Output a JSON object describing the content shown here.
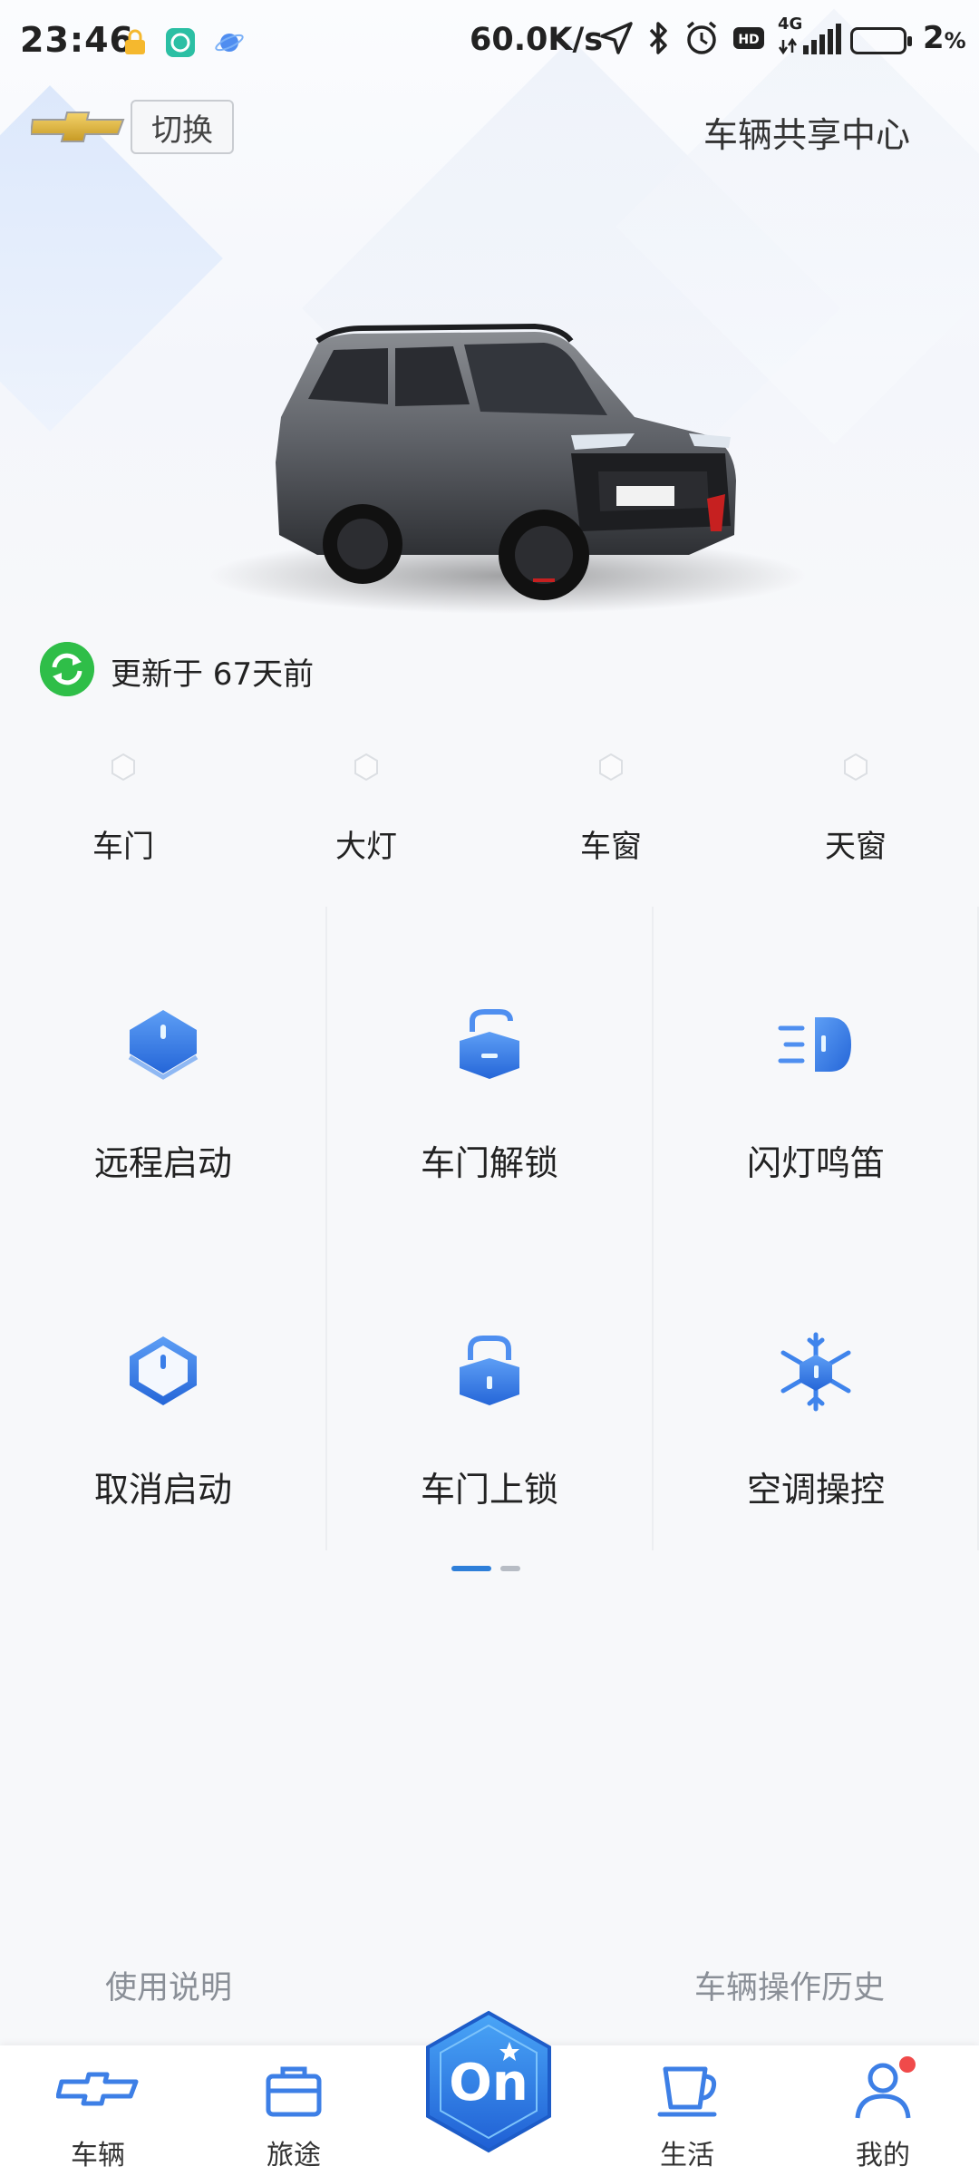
{
  "status_bar": {
    "time": "23:46",
    "net_speed": "60.0K/s",
    "battery_pct": "2",
    "battery_unit": "%",
    "network": "4G"
  },
  "header": {
    "switch_label": "切换",
    "share_center": "车辆共享中心"
  },
  "update": {
    "text": "更新于 67天前"
  },
  "vehicle_status": [
    {
      "label": "车门"
    },
    {
      "label": "大灯"
    },
    {
      "label": "车窗"
    },
    {
      "label": "天窗"
    }
  ],
  "controls": [
    {
      "label": "远程启动",
      "icon": "remote-start-icon"
    },
    {
      "label": "车门解锁",
      "icon": "unlock-icon"
    },
    {
      "label": "闪灯鸣笛",
      "icon": "flash-horn-icon"
    },
    {
      "label": "取消启动",
      "icon": "cancel-start-icon"
    },
    {
      "label": "车门上锁",
      "icon": "lock-icon"
    },
    {
      "label": "空调操控",
      "icon": "snowflake-icon"
    }
  ],
  "pager": {
    "pages": 2,
    "active": 1
  },
  "footer_links": {
    "manual": "使用说明",
    "history": "车辆操作历史"
  },
  "tabs": [
    {
      "label": "车辆",
      "icon": "chevrolet-bowtie-icon"
    },
    {
      "label": "旅途",
      "icon": "briefcase-icon"
    },
    {
      "label": "",
      "icon": "onstar-icon"
    },
    {
      "label": "生活",
      "icon": "cup-icon"
    },
    {
      "label": "我的",
      "icon": "user-icon"
    }
  ],
  "colors": {
    "accent": "#2e7fd9",
    "icon_blue": "#3b82ec",
    "update_green": "#2fbe48",
    "badge_red": "#f04a4a"
  }
}
